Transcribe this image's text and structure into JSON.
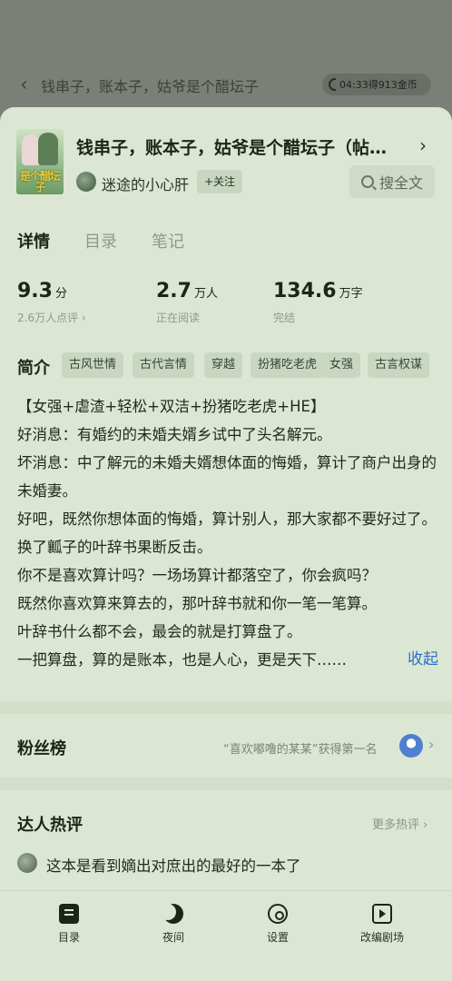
{
  "reader": {
    "chapter_title": "钱串子，账本子，姑爷是个醋坛子",
    "coin_status": "04:33得913金币"
  },
  "book": {
    "cover_text": "是个醋坛子",
    "title": "钱串子，账本子，姑爷是个醋坛子（帖…",
    "author": "迷途的小心肝",
    "follow_label": "+关注",
    "search_label": "搜全文"
  },
  "tabs": [
    {
      "label": "详情",
      "active": true
    },
    {
      "label": "目录",
      "active": false
    },
    {
      "label": "笔记",
      "active": false
    }
  ],
  "stats": {
    "score": {
      "value": "9.3",
      "unit": "分",
      "sub": "2.6万人点评 ›"
    },
    "readers": {
      "value": "2.7",
      "unit": "万人",
      "sub": "正在阅读"
    },
    "words": {
      "value": "134.6",
      "unit": "万字",
      "sub": "完结"
    }
  },
  "intro": {
    "label": "简介",
    "tags": [
      "古风世情",
      "古代言情",
      "穿越",
      "扮猪吃老虎",
      "女强",
      "古言权谋"
    ],
    "lines": [
      "【女强+虐渣+轻松+双洁+扮猪吃老虎+HE】",
      "好消息：有婚约的未婚夫婿乡试中了头名解元。",
      "坏消息：中了解元的未婚夫婿想体面的悔婚，算计了商户出身的未婚妻。",
      "好吧，既然你想体面的悔婚，算计别人，那大家都不要好过了。",
      "换了瓤子的叶辞书果断反击。",
      "你不是喜欢算计吗？一场场算计都落空了，你会疯吗？",
      "既然你喜欢算来算去的，那叶辞书就和你一笔一笔算。",
      "叶辞书什么都不会，最会的就是打算盘了。",
      "一把算盘，算的是账本，也是人心，更是天下……"
    ],
    "collapse_label": "收起"
  },
  "fans": {
    "label": "粉丝榜",
    "text": "“喜欢嘟噜的某某”获得第一名"
  },
  "reviews": {
    "label": "达人热评",
    "more_label": "更多热评",
    "first_review": "这本是看到嫡出对庶出的最好的一本了"
  },
  "bottom_nav": [
    {
      "label": "目录",
      "icon": "catalog-icon"
    },
    {
      "label": "夜间",
      "icon": "night-mode-icon"
    },
    {
      "label": "设置",
      "icon": "settings-icon"
    },
    {
      "label": "改编剧场",
      "icon": "theater-icon"
    }
  ],
  "colors": {
    "sheet_bg": "#dbe7d2",
    "overlay_bg": "#7c7f78",
    "link_blue": "#2f6fc6"
  }
}
